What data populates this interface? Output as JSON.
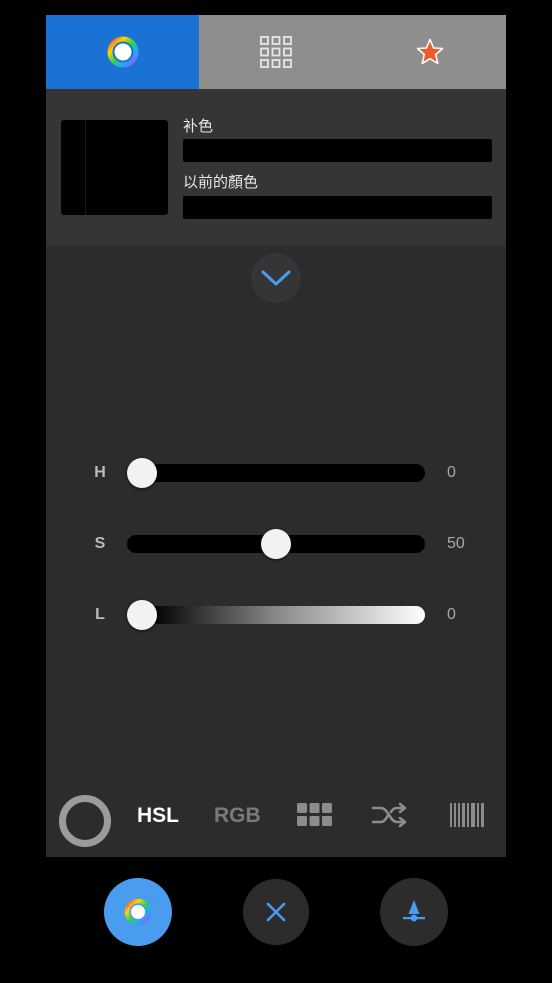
{
  "tabs": [
    {
      "icon": "color-wheel-icon",
      "active": true
    },
    {
      "icon": "grid-icon",
      "active": false
    },
    {
      "icon": "star-icon",
      "active": false
    }
  ],
  "preview": {
    "complementary_label": "补色",
    "complementary_value": "",
    "previous_label": "以前的顏色",
    "previous_value": "",
    "swatch_color": "#000000"
  },
  "expand_icon": "chevron-down-icon",
  "sliders": {
    "h": {
      "label": "H",
      "value": "0",
      "fraction": 0.0
    },
    "s": {
      "label": "S",
      "value": "50",
      "fraction": 0.5
    },
    "l": {
      "label": "L",
      "value": "0",
      "fraction": 0.0
    }
  },
  "modes": {
    "hsl": "HSL",
    "rgb": "RGB",
    "active": "HSL",
    "icons": [
      "ring-icon",
      "swatches-icon",
      "shuffle-icon",
      "barcode-icon"
    ]
  },
  "actions": [
    "color-wheel-icon",
    "close-icon",
    "eyedropper-icon"
  ],
  "colors": {
    "accent": "#1a73d4",
    "accent_light": "#4a9cee",
    "tab_inactive": "#8e8e8e",
    "panel": "#2c2c2c",
    "star": "#f05a28"
  }
}
